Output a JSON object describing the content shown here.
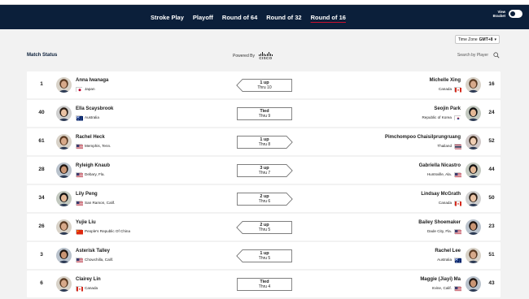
{
  "nav": {
    "tabs": [
      "Stroke Play",
      "Playoff",
      "Round of 64",
      "Round of 32",
      "Round of 16"
    ],
    "active_tab": "Round of 16",
    "view_bracket_line1": "View",
    "view_bracket_line2": "Bracket"
  },
  "timezone": {
    "label": "Time Zone",
    "value": "GMT+8",
    "caret": "▾"
  },
  "toolbar": {
    "match_status": "Match Status",
    "powered_by": "Powered By",
    "sponsor": "CISCO",
    "search_label": "Search by Player",
    "search_icon": "search-icon"
  },
  "matches": [
    {
      "left": {
        "seed": "1",
        "name": "Anna Iwanaga",
        "location": "Japan",
        "flag": "jp"
      },
      "score": {
        "line1": "1 up",
        "line2": "Thru 10",
        "leader": "left"
      },
      "right": {
        "seed": "16",
        "name": "Michelle Xing",
        "location": "Canada",
        "flag": "ca"
      }
    },
    {
      "left": {
        "seed": "40",
        "name": "Ella Scaysbrook",
        "location": "Australia",
        "flag": "au"
      },
      "score": {
        "line1": "Tied",
        "line2": "Thru 9",
        "leader": "none"
      },
      "right": {
        "seed": "24",
        "name": "Seojin Park",
        "location": "Republic of Korea",
        "flag": "kr"
      }
    },
    {
      "left": {
        "seed": "61",
        "name": "Rachel Heck",
        "location": "Memphis, Tenn.",
        "flag": "us"
      },
      "score": {
        "line1": "1 up",
        "line2": "Thru 8",
        "leader": "right"
      },
      "right": {
        "seed": "52",
        "name": "Pimchompoo Chaisilprungruang",
        "location": "Thailand",
        "flag": "th"
      }
    },
    {
      "left": {
        "seed": "28",
        "name": "Ryleigh Knaub",
        "location": "Debary, Fla.",
        "flag": "us"
      },
      "score": {
        "line1": "3 up",
        "line2": "Thru 7",
        "leader": "right"
      },
      "right": {
        "seed": "44",
        "name": "Gabriella Nicastro",
        "location": "Huntsville, Ala.",
        "flag": "us"
      }
    },
    {
      "left": {
        "seed": "34",
        "name": "Lily Peng",
        "location": "San Ramon, Calif.",
        "flag": "us"
      },
      "score": {
        "line1": "2 up",
        "line2": "Thru 6",
        "leader": "right"
      },
      "right": {
        "seed": "50",
        "name": "Lindsay McGrath",
        "location": "Canada",
        "flag": "ca"
      }
    },
    {
      "left": {
        "seed": "26",
        "name": "Yujie Liu",
        "location": "People's Republic Of China",
        "flag": "cn"
      },
      "score": {
        "line1": "2 up",
        "line2": "Thru 5",
        "leader": "left"
      },
      "right": {
        "seed": "23",
        "name": "Bailey Shoemaker",
        "location": "Dade City, Fla.",
        "flag": "us"
      }
    },
    {
      "left": {
        "seed": "3",
        "name": "Asterisk Talley",
        "location": "Chowchilla, Calif.",
        "flag": "us"
      },
      "score": {
        "line1": "1 up",
        "line2": "Thru 5",
        "leader": "left"
      },
      "right": {
        "seed": "51",
        "name": "Rachel Lee",
        "location": "Australia",
        "flag": "au"
      }
    },
    {
      "left": {
        "seed": "6",
        "name": "Clairey Lin",
        "location": "Canada",
        "flag": "ca"
      },
      "score": {
        "line1": "Tied",
        "line2": "Thru 4",
        "leader": "none"
      },
      "right": {
        "seed": "43",
        "name": "Maggie (Jiayi) Ma",
        "location": "Irvine, Calif.",
        "flag": "us"
      }
    }
  ],
  "colors": {
    "nav_bg": "#0b1f3a",
    "page_bg": "#f2f2f2",
    "accent_underline": "#c8102e"
  }
}
